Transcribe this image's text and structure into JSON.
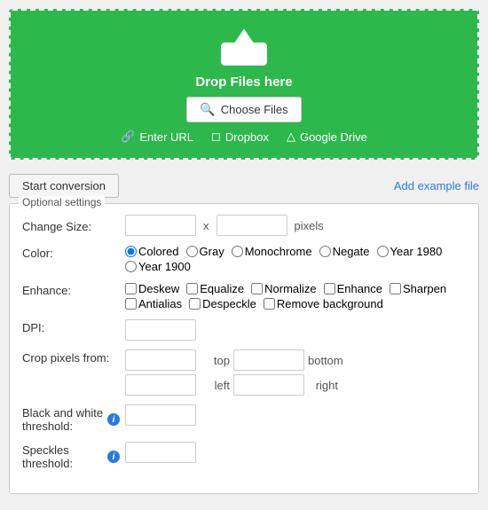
{
  "upload": {
    "drop_text": "Drop Files here",
    "choose_files_label": "Choose Files",
    "enter_url_label": "Enter URL",
    "dropbox_label": "Dropbox",
    "google_drive_label": "Google Drive"
  },
  "toolbar": {
    "start_label": "Start conversion",
    "add_example_label": "Add example file"
  },
  "settings": {
    "legend": "Optional settings",
    "change_size_label": "Change Size:",
    "x_separator": "x",
    "pixels_label": "pixels",
    "color_label": "Color:",
    "color_options": [
      "Colored",
      "Gray",
      "Monochrome",
      "Negate",
      "Year 1980",
      "Year 1900"
    ],
    "enhance_label": "Enhance:",
    "enhance_options": [
      "Deskew",
      "Equalize",
      "Normalize",
      "Enhance",
      "Sharpen",
      "Antialias",
      "Despeckle",
      "Remove background"
    ],
    "dpi_label": "DPI:",
    "crop_label": "Crop pixels from:",
    "crop_top": "top",
    "crop_bottom": "bottom",
    "crop_left": "left",
    "crop_right": "right",
    "bw_label": "Black and white threshold:",
    "speckles_label": "Speckles threshold:"
  }
}
